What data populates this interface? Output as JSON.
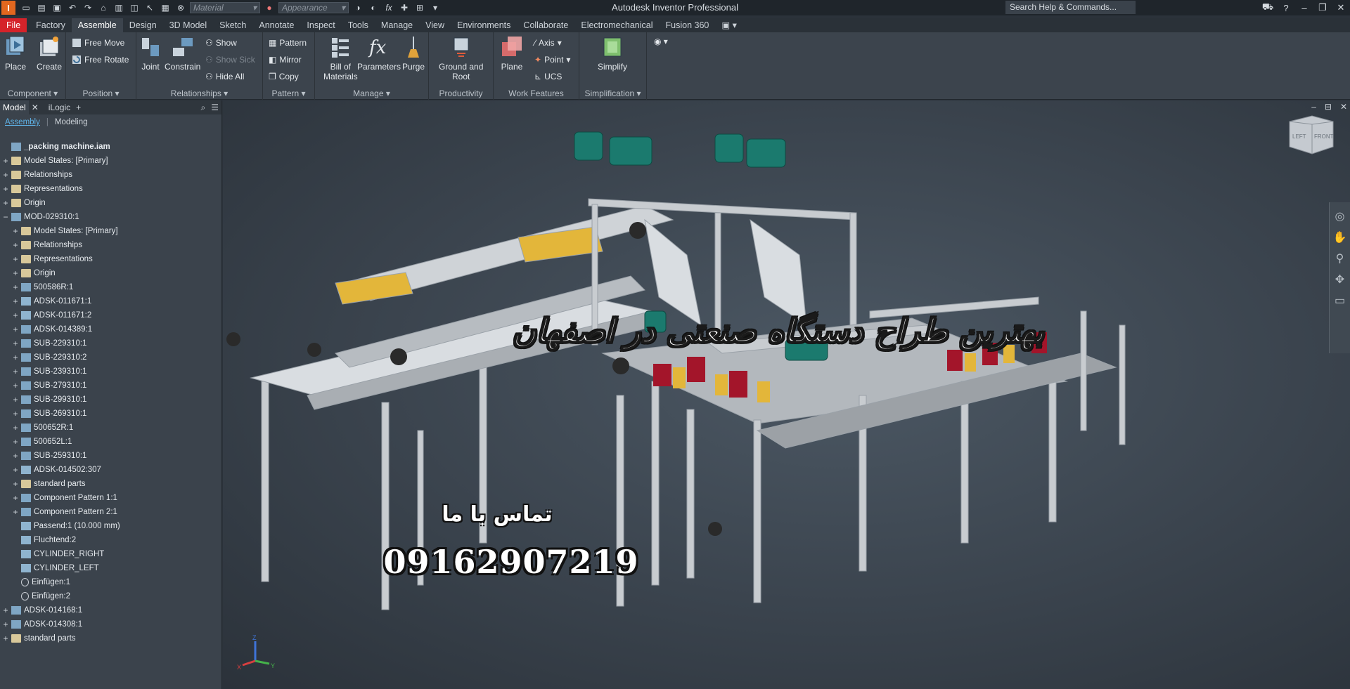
{
  "app": {
    "title": "Autodesk Inventor Professional",
    "search_placeholder": "Search Help & Commands...",
    "material_placeholder": "Material",
    "appearance_placeholder": "Appearance",
    "logo_letter": "I"
  },
  "ribbon_tabs": [
    "File",
    "Factory",
    "Assemble",
    "Design",
    "3D Model",
    "Sketch",
    "Annotate",
    "Inspect",
    "Tools",
    "Manage",
    "View",
    "Environments",
    "Collaborate",
    "Electromechanical",
    "Fusion 360"
  ],
  "active_tab": "Assemble",
  "ribbon": {
    "component": {
      "label": "Component",
      "place": "Place",
      "create": "Create"
    },
    "position": {
      "label": "Position",
      "free_move": "Free Move",
      "free_rotate": "Free Rotate"
    },
    "relationships": {
      "label": "Relationships",
      "joint": "Joint",
      "constrain": "Constrain",
      "show": "Show",
      "show_sick": "Show Sick",
      "hide_all": "Hide All"
    },
    "pattern": {
      "label": "Pattern",
      "pattern": "Pattern",
      "mirror": "Mirror",
      "copy": "Copy"
    },
    "manage": {
      "label": "Manage",
      "bom_line1": "Bill of",
      "bom_line2": "Materials",
      "parameters": "Parameters",
      "purge": "Purge"
    },
    "productivity": {
      "label": "Productivity",
      "ground_line1": "Ground and",
      "ground_line2": "Root"
    },
    "work_features": {
      "label": "Work Features",
      "plane": "Plane",
      "axis": "Axis",
      "point": "Point",
      "ucs": "UCS"
    },
    "simplification": {
      "label": "Simplification",
      "simplify": "Simplify"
    }
  },
  "browser": {
    "tabs": [
      "Model",
      "iLogic"
    ],
    "subtabs": [
      "Assembly",
      "Modeling"
    ],
    "tree": [
      {
        "label": "_packing machine.iam",
        "level": 0,
        "exp": "",
        "icon": "asm",
        "root": true
      },
      {
        "label": "Model States: [Primary]",
        "level": 0,
        "exp": "+",
        "icon": "folder"
      },
      {
        "label": "Relationships",
        "level": 0,
        "exp": "+",
        "icon": "folder"
      },
      {
        "label": "Representations",
        "level": 0,
        "exp": "+",
        "icon": "folder"
      },
      {
        "label": "Origin",
        "level": 0,
        "exp": "+",
        "icon": "folder"
      },
      {
        "label": "MOD-029310:1",
        "level": 0,
        "exp": "−",
        "icon": "asm"
      },
      {
        "label": "Model States: [Primary]",
        "level": 1,
        "exp": "+",
        "icon": "folder"
      },
      {
        "label": "Relationships",
        "level": 1,
        "exp": "+",
        "icon": "folder"
      },
      {
        "label": "Representations",
        "level": 1,
        "exp": "+",
        "icon": "folder"
      },
      {
        "label": "Origin",
        "level": 1,
        "exp": "+",
        "icon": "folder"
      },
      {
        "label": "500586R:1",
        "level": 1,
        "exp": "+",
        "icon": "asm"
      },
      {
        "label": "ADSK-011671:1",
        "level": 1,
        "exp": "+",
        "icon": "part"
      },
      {
        "label": "ADSK-011671:2",
        "level": 1,
        "exp": "+",
        "icon": "part"
      },
      {
        "label": "ADSK-014389:1",
        "level": 1,
        "exp": "+",
        "icon": "asm"
      },
      {
        "label": "SUB-229310:1",
        "level": 1,
        "exp": "+",
        "icon": "asm"
      },
      {
        "label": "SUB-229310:2",
        "level": 1,
        "exp": "+",
        "icon": "asm"
      },
      {
        "label": "SUB-239310:1",
        "level": 1,
        "exp": "+",
        "icon": "asm"
      },
      {
        "label": "SUB-279310:1",
        "level": 1,
        "exp": "+",
        "icon": "asm"
      },
      {
        "label": "SUB-299310:1",
        "level": 1,
        "exp": "+",
        "icon": "asm"
      },
      {
        "label": "SUB-269310:1",
        "level": 1,
        "exp": "+",
        "icon": "asm"
      },
      {
        "label": "500652R:1",
        "level": 1,
        "exp": "+",
        "icon": "asm"
      },
      {
        "label": "500652L:1",
        "level": 1,
        "exp": "+",
        "icon": "asm"
      },
      {
        "label": "SUB-259310:1",
        "level": 1,
        "exp": "+",
        "icon": "asm"
      },
      {
        "label": "ADSK-014502:307",
        "level": 1,
        "exp": "+",
        "icon": "part"
      },
      {
        "label": "standard parts",
        "level": 1,
        "exp": "+",
        "icon": "folder"
      },
      {
        "label": "Component Pattern 1:1",
        "level": 1,
        "exp": "+",
        "icon": "asm"
      },
      {
        "label": "Component Pattern 2:1",
        "level": 1,
        "exp": "+",
        "icon": "asm"
      },
      {
        "label": "Passend:1 (10.000 mm)",
        "level": 1,
        "exp": "",
        "icon": "part"
      },
      {
        "label": "Fluchtend:2",
        "level": 1,
        "exp": "",
        "icon": "part"
      },
      {
        "label": "CYLINDER_RIGHT",
        "level": 1,
        "exp": "",
        "icon": "part"
      },
      {
        "label": "CYLINDER_LEFT",
        "level": 1,
        "exp": "",
        "icon": "part"
      },
      {
        "label": "Einfügen:1",
        "level": 1,
        "exp": "",
        "icon": "constraint"
      },
      {
        "label": "Einfügen:2",
        "level": 1,
        "exp": "",
        "icon": "constraint"
      },
      {
        "label": "ADSK-014168:1",
        "level": 0,
        "exp": "+",
        "icon": "asm"
      },
      {
        "label": "ADSK-014308:1",
        "level": 0,
        "exp": "+",
        "icon": "asm"
      },
      {
        "label": "standard parts",
        "level": 0,
        "exp": "+",
        "icon": "folder"
      }
    ]
  },
  "viewport": {
    "overlay_line1": "بهترین طراح دستگاه صنعتی در اصفهان",
    "contact_text": "تماس با ما",
    "phone": "09162907219",
    "viewcube_left": "LEFT",
    "viewcube_front": "FRONT",
    "triad_x": "X",
    "triad_y": "Y",
    "triad_z": "Z"
  },
  "colors": {
    "file_tab": "#d5232a",
    "logo": "#e2671f",
    "motor": "#1b7a6e",
    "frame": "#c8ccd0",
    "accent_yellow": "#e3b63a",
    "accent_red": "#a3152a"
  }
}
